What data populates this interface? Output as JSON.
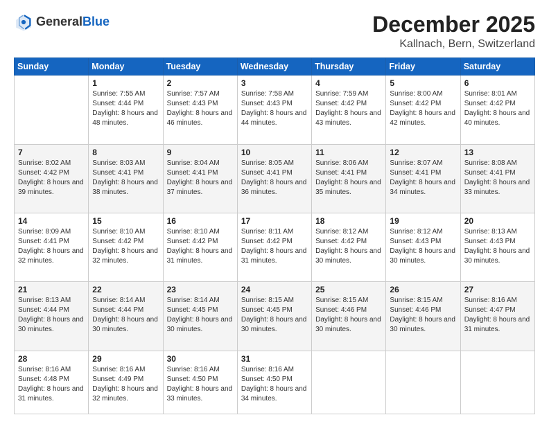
{
  "header": {
    "logo_general": "General",
    "logo_blue": "Blue",
    "month_title": "December 2025",
    "location": "Kallnach, Bern, Switzerland"
  },
  "days_of_week": [
    "Sunday",
    "Monday",
    "Tuesday",
    "Wednesday",
    "Thursday",
    "Friday",
    "Saturday"
  ],
  "weeks": [
    [
      {
        "day": "",
        "sunrise": "",
        "sunset": "",
        "daylight": ""
      },
      {
        "day": "1",
        "sunrise": "Sunrise: 7:55 AM",
        "sunset": "Sunset: 4:44 PM",
        "daylight": "Daylight: 8 hours and 48 minutes."
      },
      {
        "day": "2",
        "sunrise": "Sunrise: 7:57 AM",
        "sunset": "Sunset: 4:43 PM",
        "daylight": "Daylight: 8 hours and 46 minutes."
      },
      {
        "day": "3",
        "sunrise": "Sunrise: 7:58 AM",
        "sunset": "Sunset: 4:43 PM",
        "daylight": "Daylight: 8 hours and 44 minutes."
      },
      {
        "day": "4",
        "sunrise": "Sunrise: 7:59 AM",
        "sunset": "Sunset: 4:42 PM",
        "daylight": "Daylight: 8 hours and 43 minutes."
      },
      {
        "day": "5",
        "sunrise": "Sunrise: 8:00 AM",
        "sunset": "Sunset: 4:42 PM",
        "daylight": "Daylight: 8 hours and 42 minutes."
      },
      {
        "day": "6",
        "sunrise": "Sunrise: 8:01 AM",
        "sunset": "Sunset: 4:42 PM",
        "daylight": "Daylight: 8 hours and 40 minutes."
      }
    ],
    [
      {
        "day": "7",
        "sunrise": "Sunrise: 8:02 AM",
        "sunset": "Sunset: 4:42 PM",
        "daylight": "Daylight: 8 hours and 39 minutes."
      },
      {
        "day": "8",
        "sunrise": "Sunrise: 8:03 AM",
        "sunset": "Sunset: 4:41 PM",
        "daylight": "Daylight: 8 hours and 38 minutes."
      },
      {
        "day": "9",
        "sunrise": "Sunrise: 8:04 AM",
        "sunset": "Sunset: 4:41 PM",
        "daylight": "Daylight: 8 hours and 37 minutes."
      },
      {
        "day": "10",
        "sunrise": "Sunrise: 8:05 AM",
        "sunset": "Sunset: 4:41 PM",
        "daylight": "Daylight: 8 hours and 36 minutes."
      },
      {
        "day": "11",
        "sunrise": "Sunrise: 8:06 AM",
        "sunset": "Sunset: 4:41 PM",
        "daylight": "Daylight: 8 hours and 35 minutes."
      },
      {
        "day": "12",
        "sunrise": "Sunrise: 8:07 AM",
        "sunset": "Sunset: 4:41 PM",
        "daylight": "Daylight: 8 hours and 34 minutes."
      },
      {
        "day": "13",
        "sunrise": "Sunrise: 8:08 AM",
        "sunset": "Sunset: 4:41 PM",
        "daylight": "Daylight: 8 hours and 33 minutes."
      }
    ],
    [
      {
        "day": "14",
        "sunrise": "Sunrise: 8:09 AM",
        "sunset": "Sunset: 4:41 PM",
        "daylight": "Daylight: 8 hours and 32 minutes."
      },
      {
        "day": "15",
        "sunrise": "Sunrise: 8:10 AM",
        "sunset": "Sunset: 4:42 PM",
        "daylight": "Daylight: 8 hours and 32 minutes."
      },
      {
        "day": "16",
        "sunrise": "Sunrise: 8:10 AM",
        "sunset": "Sunset: 4:42 PM",
        "daylight": "Daylight: 8 hours and 31 minutes."
      },
      {
        "day": "17",
        "sunrise": "Sunrise: 8:11 AM",
        "sunset": "Sunset: 4:42 PM",
        "daylight": "Daylight: 8 hours and 31 minutes."
      },
      {
        "day": "18",
        "sunrise": "Sunrise: 8:12 AM",
        "sunset": "Sunset: 4:42 PM",
        "daylight": "Daylight: 8 hours and 30 minutes."
      },
      {
        "day": "19",
        "sunrise": "Sunrise: 8:12 AM",
        "sunset": "Sunset: 4:43 PM",
        "daylight": "Daylight: 8 hours and 30 minutes."
      },
      {
        "day": "20",
        "sunrise": "Sunrise: 8:13 AM",
        "sunset": "Sunset: 4:43 PM",
        "daylight": "Daylight: 8 hours and 30 minutes."
      }
    ],
    [
      {
        "day": "21",
        "sunrise": "Sunrise: 8:13 AM",
        "sunset": "Sunset: 4:44 PM",
        "daylight": "Daylight: 8 hours and 30 minutes."
      },
      {
        "day": "22",
        "sunrise": "Sunrise: 8:14 AM",
        "sunset": "Sunset: 4:44 PM",
        "daylight": "Daylight: 8 hours and 30 minutes."
      },
      {
        "day": "23",
        "sunrise": "Sunrise: 8:14 AM",
        "sunset": "Sunset: 4:45 PM",
        "daylight": "Daylight: 8 hours and 30 minutes."
      },
      {
        "day": "24",
        "sunrise": "Sunrise: 8:15 AM",
        "sunset": "Sunset: 4:45 PM",
        "daylight": "Daylight: 8 hours and 30 minutes."
      },
      {
        "day": "25",
        "sunrise": "Sunrise: 8:15 AM",
        "sunset": "Sunset: 4:46 PM",
        "daylight": "Daylight: 8 hours and 30 minutes."
      },
      {
        "day": "26",
        "sunrise": "Sunrise: 8:15 AM",
        "sunset": "Sunset: 4:46 PM",
        "daylight": "Daylight: 8 hours and 30 minutes."
      },
      {
        "day": "27",
        "sunrise": "Sunrise: 8:16 AM",
        "sunset": "Sunset: 4:47 PM",
        "daylight": "Daylight: 8 hours and 31 minutes."
      }
    ],
    [
      {
        "day": "28",
        "sunrise": "Sunrise: 8:16 AM",
        "sunset": "Sunset: 4:48 PM",
        "daylight": "Daylight: 8 hours and 31 minutes."
      },
      {
        "day": "29",
        "sunrise": "Sunrise: 8:16 AM",
        "sunset": "Sunset: 4:49 PM",
        "daylight": "Daylight: 8 hours and 32 minutes."
      },
      {
        "day": "30",
        "sunrise": "Sunrise: 8:16 AM",
        "sunset": "Sunset: 4:50 PM",
        "daylight": "Daylight: 8 hours and 33 minutes."
      },
      {
        "day": "31",
        "sunrise": "Sunrise: 8:16 AM",
        "sunset": "Sunset: 4:50 PM",
        "daylight": "Daylight: 8 hours and 34 minutes."
      },
      {
        "day": "",
        "sunrise": "",
        "sunset": "",
        "daylight": ""
      },
      {
        "day": "",
        "sunrise": "",
        "sunset": "",
        "daylight": ""
      },
      {
        "day": "",
        "sunrise": "",
        "sunset": "",
        "daylight": ""
      }
    ]
  ]
}
